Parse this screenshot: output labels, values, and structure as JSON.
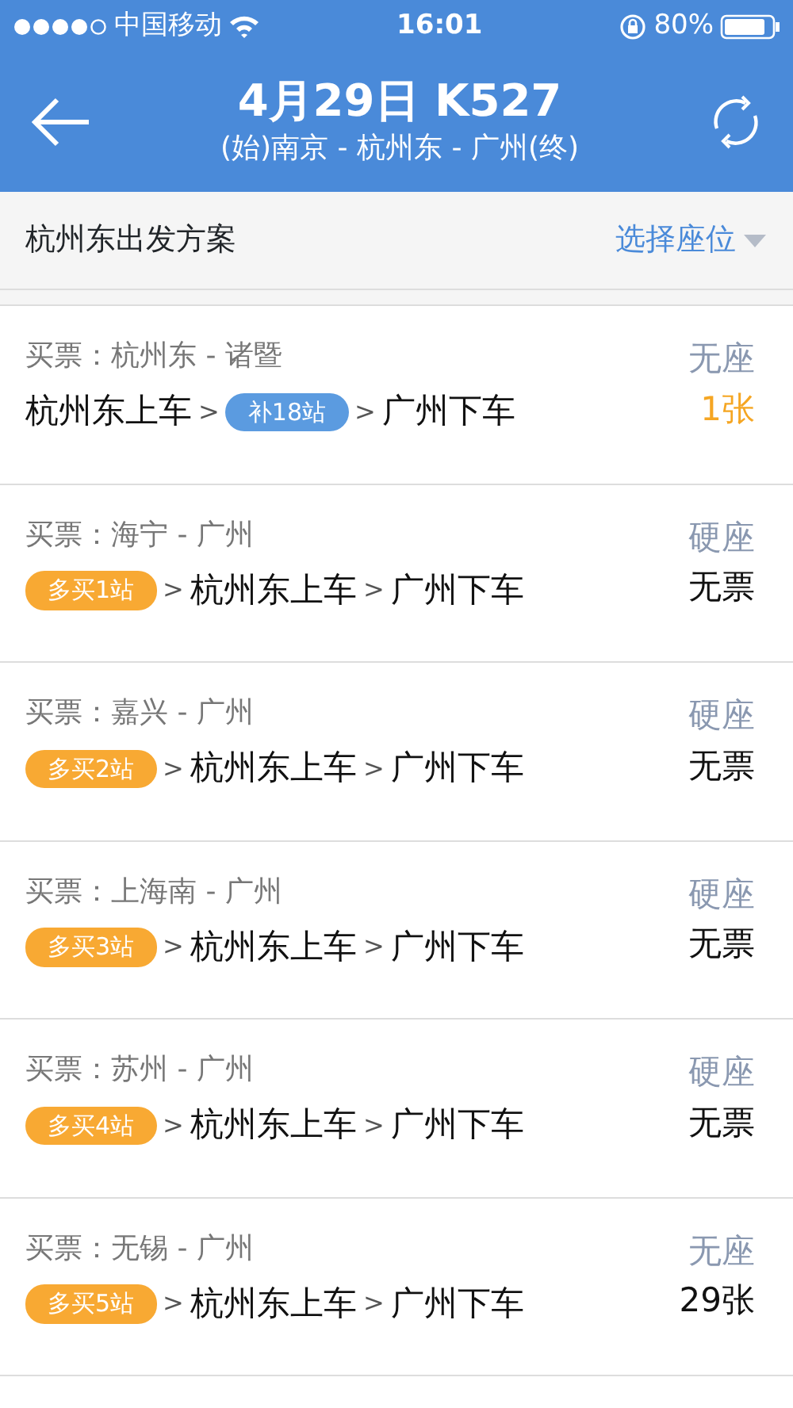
{
  "status_bar": {
    "carrier": "中国移动",
    "time": "16:01",
    "battery": "80%"
  },
  "header": {
    "title": "4月29日 K527",
    "route": "(始)南京 - 杭州东 - 广州(终)"
  },
  "subheader": {
    "title": "杭州东出发方案",
    "seat_picker": "选择座位"
  },
  "plans": [
    {
      "buy": "买票：杭州东 - 诸暨",
      "route": [
        {
          "kind": "stop",
          "text": "杭州东上车"
        },
        {
          "kind": "arrow",
          "text": ">"
        },
        {
          "kind": "tag",
          "text": "补18站",
          "color": "#5b9be0"
        },
        {
          "kind": "arrow",
          "text": ">"
        },
        {
          "kind": "stop",
          "text": "广州下车"
        }
      ],
      "seat": "无座",
      "availability": "1张",
      "color": "#f5a623"
    },
    {
      "buy": "买票：海宁 - 广州",
      "route": [
        {
          "kind": "tag",
          "text": "多买1站",
          "color": "#f8a933"
        },
        {
          "kind": "arrow",
          "text": ">"
        },
        {
          "kind": "stop",
          "text": "杭州东上车"
        },
        {
          "kind": "arrow",
          "text": ">"
        },
        {
          "kind": "stop",
          "text": "广州下车"
        }
      ],
      "seat": "硬座",
      "availability": "无票",
      "color": "#111111"
    },
    {
      "buy": "买票：嘉兴 - 广州",
      "route": [
        {
          "kind": "tag",
          "text": "多买2站",
          "color": "#f8a933"
        },
        {
          "kind": "arrow",
          "text": ">"
        },
        {
          "kind": "stop",
          "text": "杭州东上车"
        },
        {
          "kind": "arrow",
          "text": ">"
        },
        {
          "kind": "stop",
          "text": "广州下车"
        }
      ],
      "seat": "硬座",
      "availability": "无票",
      "color": "#111111"
    },
    {
      "buy": "买票：上海南 - 广州",
      "route": [
        {
          "kind": "tag",
          "text": "多买3站",
          "color": "#f8a933"
        },
        {
          "kind": "arrow",
          "text": ">"
        },
        {
          "kind": "stop",
          "text": "杭州东上车"
        },
        {
          "kind": "arrow",
          "text": ">"
        },
        {
          "kind": "stop",
          "text": "广州下车"
        }
      ],
      "seat": "硬座",
      "availability": "无票",
      "color": "#111111"
    },
    {
      "buy": "买票：苏州 - 广州",
      "route": [
        {
          "kind": "tag",
          "text": "多买4站",
          "color": "#f8a933"
        },
        {
          "kind": "arrow",
          "text": ">"
        },
        {
          "kind": "stop",
          "text": "杭州东上车"
        },
        {
          "kind": "arrow",
          "text": ">"
        },
        {
          "kind": "stop",
          "text": "广州下车"
        }
      ],
      "seat": "硬座",
      "availability": "无票",
      "color": "#111111"
    },
    {
      "buy": "买票：无锡 - 广州",
      "route": [
        {
          "kind": "tag",
          "text": "多买5站",
          "color": "#f8a933"
        },
        {
          "kind": "arrow",
          "text": ">"
        },
        {
          "kind": "stop",
          "text": "杭州东上车"
        },
        {
          "kind": "arrow",
          "text": ">"
        },
        {
          "kind": "stop",
          "text": "广州下车"
        }
      ],
      "seat": "无座",
      "availability": "29张",
      "color": "#111111"
    }
  ]
}
